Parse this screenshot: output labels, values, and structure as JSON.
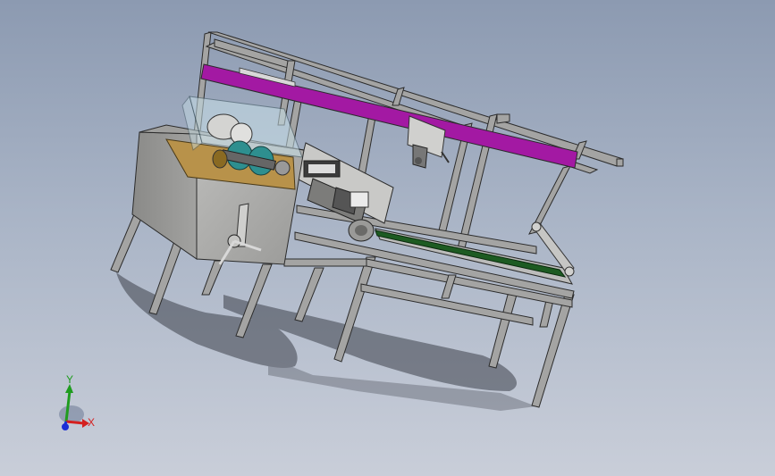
{
  "viewport": {
    "background_top": "#8c9ab1",
    "background_bottom": "#c9ced9"
  },
  "model": {
    "frame_color": "#a4a4a3",
    "frame_edge": "#2b2b2b",
    "beam_color": "#a319a3",
    "belt_color": "#1d5b22",
    "guard_color": "#c8e0e8",
    "motor_color": "#2e8f8f",
    "plate_color": "#b8924a"
  },
  "triad": {
    "y_label": "Y",
    "x_label": "X",
    "y_color": "#1f9c1f",
    "x_color": "#d42020",
    "z_color": "#1c2fd6"
  }
}
